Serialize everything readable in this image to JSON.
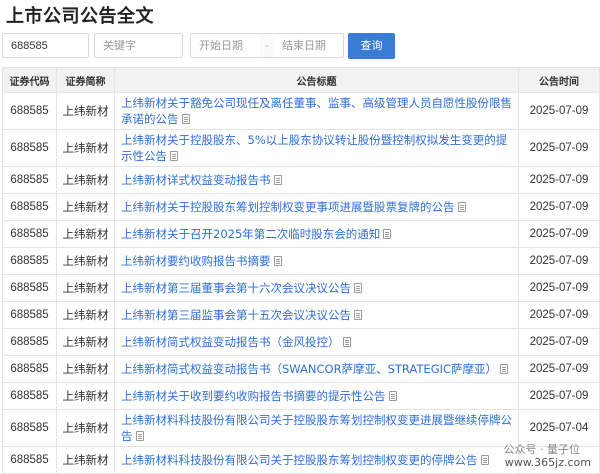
{
  "page": {
    "title": "上市公司公告全文"
  },
  "search": {
    "code_value": "688585",
    "keyword_placeholder": "关键字",
    "start_placeholder": "开始日期",
    "separator": "-",
    "end_placeholder": "结束日期",
    "query_label": "查询"
  },
  "table": {
    "headers": [
      "证券代码",
      "证券简称",
      "公告标题",
      "公告时间"
    ],
    "rows": [
      {
        "code": "688585",
        "name": "上纬新材",
        "title": "上纬新材关于豁免公司现任及离任董事、监事、高级管理人员自愿性股份限售承诺的公告",
        "time": "2025-07-09"
      },
      {
        "code": "688585",
        "name": "上纬新材",
        "title": "上纬新材关于控股股东、5%以上股东协议转让股份暨控制权拟发生变更的提示性公告",
        "time": "2025-07-09"
      },
      {
        "code": "688585",
        "name": "上纬新材",
        "title": "上纬新材详式权益变动报告书",
        "time": "2025-07-09"
      },
      {
        "code": "688585",
        "name": "上纬新材",
        "title": "上纬新材关于控股股东筹划控制权变更事项进展暨股票复牌的公告",
        "time": "2025-07-09"
      },
      {
        "code": "688585",
        "name": "上纬新材",
        "title": "上纬新材关于召开2025年第二次临时股东会的通知",
        "time": "2025-07-09"
      },
      {
        "code": "688585",
        "name": "上纬新材",
        "title": "上纬新材要约收购报告书摘要",
        "time": "2025-07-09"
      },
      {
        "code": "688585",
        "name": "上纬新材",
        "title": "上纬新材第三届董事会第十六次会议决议公告",
        "time": "2025-07-09"
      },
      {
        "code": "688585",
        "name": "上纬新材",
        "title": "上纬新材第三届监事会第十五次会议决议公告",
        "time": "2025-07-09"
      },
      {
        "code": "688585",
        "name": "上纬新材",
        "title": "上纬新材简式权益变动报告书（金风投控）",
        "time": "2025-07-09"
      },
      {
        "code": "688585",
        "name": "上纬新材",
        "title": "上纬新材简式权益变动报告书（SWANCOR萨摩亚、STRATEGIC萨摩亚）",
        "time": "2025-07-09"
      },
      {
        "code": "688585",
        "name": "上纬新材",
        "title": "上纬新材关于收到要约收购报告书摘要的提示性公告",
        "time": "2025-07-09"
      },
      {
        "code": "688585",
        "name": "上纬新材",
        "title": "上纬新材料科技股份有限公司关于控股股东筹划控制权变更进展暨继续停牌公告",
        "time": "2025-07-04"
      },
      {
        "code": "688585",
        "name": "上纬新材",
        "title": "上纬新材料科技股份有限公司关于控股股东筹划控制权变更的停牌公告",
        "time": ""
      }
    ]
  },
  "watermark": {
    "line1": "公众号 · 量子位",
    "line2": "www.365jz.com"
  },
  "colors": {
    "link": "#2f6fd6",
    "button": "#3a7bd5"
  }
}
